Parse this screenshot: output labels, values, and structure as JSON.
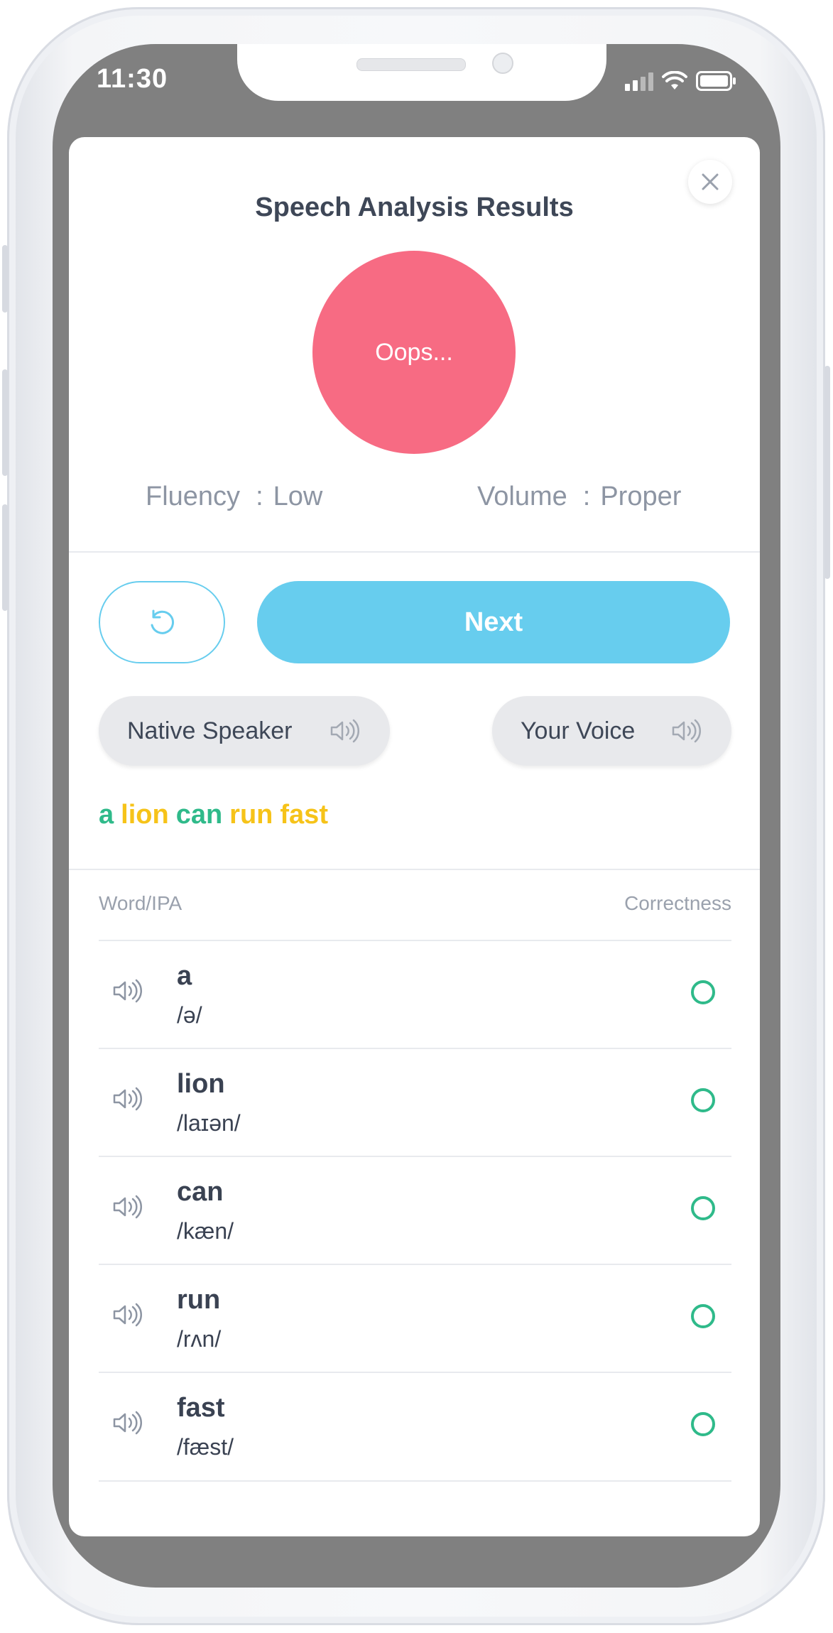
{
  "status_bar": {
    "time": "11:30"
  },
  "header": {
    "title": "Speech Analysis Results"
  },
  "result": {
    "label": "Oops...",
    "color": "#f76b83"
  },
  "metrics": {
    "fluency": {
      "label": "Fluency",
      "separator": ":",
      "value": "Low"
    },
    "volume": {
      "label": "Volume",
      "separator": ":",
      "value": "Proper"
    }
  },
  "actions": {
    "next_label": "Next",
    "retry_icon": "retry-icon"
  },
  "playback": {
    "native_label": "Native Speaker",
    "voice_label": "Your Voice",
    "icon": "speaker-icon"
  },
  "sentence": [
    {
      "text": "a",
      "color": "#2fba8a"
    },
    {
      "text": "lion",
      "color": "#f6c319"
    },
    {
      "text": "can",
      "color": "#2fba8a"
    },
    {
      "text": "run",
      "color": "#f6c319"
    },
    {
      "text": "fast",
      "color": "#f6c319"
    }
  ],
  "table": {
    "col_word": "Word/IPA",
    "col_correct": "Correctness",
    "rows": [
      {
        "word": "a",
        "ipa": "/ə/",
        "mark": "circle"
      },
      {
        "word": "lion",
        "ipa": "/laɪən/",
        "mark": "circle"
      },
      {
        "word": "can",
        "ipa": "/kæn/",
        "mark": "circle"
      },
      {
        "word": "run",
        "ipa": "/rʌn/",
        "mark": "circle"
      },
      {
        "word": "fast",
        "ipa": "/fæst/",
        "mark": "circle"
      }
    ]
  },
  "colors": {
    "accent": "#67cdee",
    "correct": "#2fba8a",
    "warn": "#f6c319",
    "text": "#3e4757",
    "muted": "#8d95a3"
  }
}
